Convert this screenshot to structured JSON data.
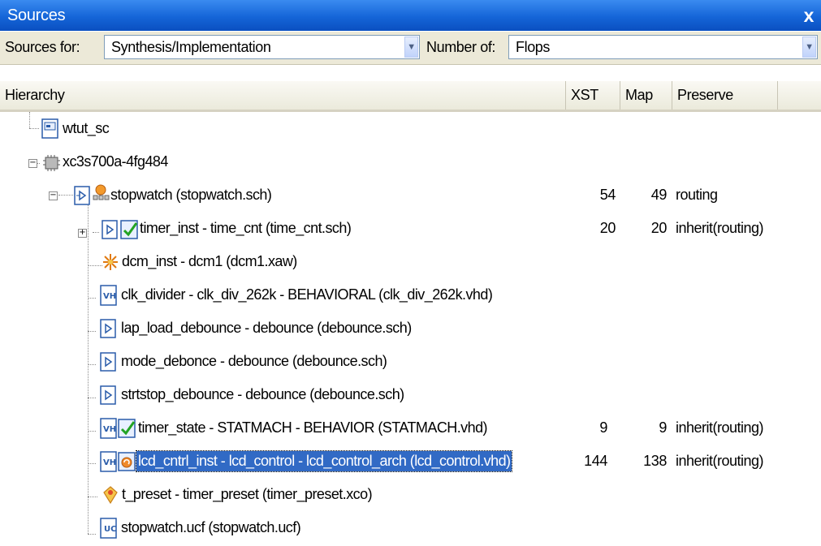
{
  "panel": {
    "title": "Sources",
    "close_label": "x"
  },
  "options": {
    "sources_for_label": "Sources for:",
    "sources_for_value": "Synthesis/Implementation",
    "number_of_label": "Number of:",
    "number_of_value": "Flops"
  },
  "columns": {
    "hierarchy": "Hierarchy",
    "xst": "XST",
    "map": "Map",
    "preserve": "Preserve"
  },
  "rows": [
    {
      "label": "wtut_sc",
      "icon": "project-file-icon"
    },
    {
      "label": "xc3s700a-4fg484",
      "icon": "chip-icon",
      "expander": "−"
    },
    {
      "label": "stopwatch (stopwatch.sch)",
      "icon": "schematic-top-module-icon",
      "expander": "−",
      "xst": "54",
      "map": "49",
      "preserve": "routing"
    },
    {
      "label": "timer_inst - time_cnt (time_cnt.sch)",
      "icon": "schematic-checked-icon",
      "expander": "+",
      "xst": "20",
      "map": "20",
      "preserve": "inherit(routing)"
    },
    {
      "label": "dcm_inst - dcm1 (dcm1.xaw)",
      "icon": "dcm-wizard-icon"
    },
    {
      "label": "clk_divider - clk_div_262k - BEHAVIORAL (clk_div_262k.vhd)",
      "icon": "vhdl-file-icon"
    },
    {
      "label": "lap_load_debounce - debounce (debounce.sch)",
      "icon": "schematic-icon"
    },
    {
      "label": "mode_debonce - debounce (debounce.sch)",
      "icon": "schematic-icon"
    },
    {
      "label": "strtstop_debounce - debounce (debounce.sch)",
      "icon": "schematic-icon"
    },
    {
      "label": "timer_state - STATMACH - BEHAVIOR (STATMACH.vhd)",
      "icon": "vhdl-checked-icon",
      "xst": "9",
      "map": "9",
      "preserve": "inherit(routing)"
    },
    {
      "label": "lcd_cntrl_inst - lcd_control - lcd_control_arch (lcd_control.vhd)",
      "icon": "vhdl-refresh-icon",
      "xst": "144",
      "map": "138",
      "preserve": "inherit(routing)",
      "selected": true
    },
    {
      "label": "t_preset - timer_preset (timer_preset.xco)",
      "icon": "coregen-icon"
    },
    {
      "label": "stopwatch.ucf (stopwatch.ucf)",
      "icon": "ucf-file-icon"
    }
  ],
  "colors": {
    "title_bar": "#1565d8",
    "selection": "#316ac5",
    "toolbar_bg": "#ece9d8"
  }
}
